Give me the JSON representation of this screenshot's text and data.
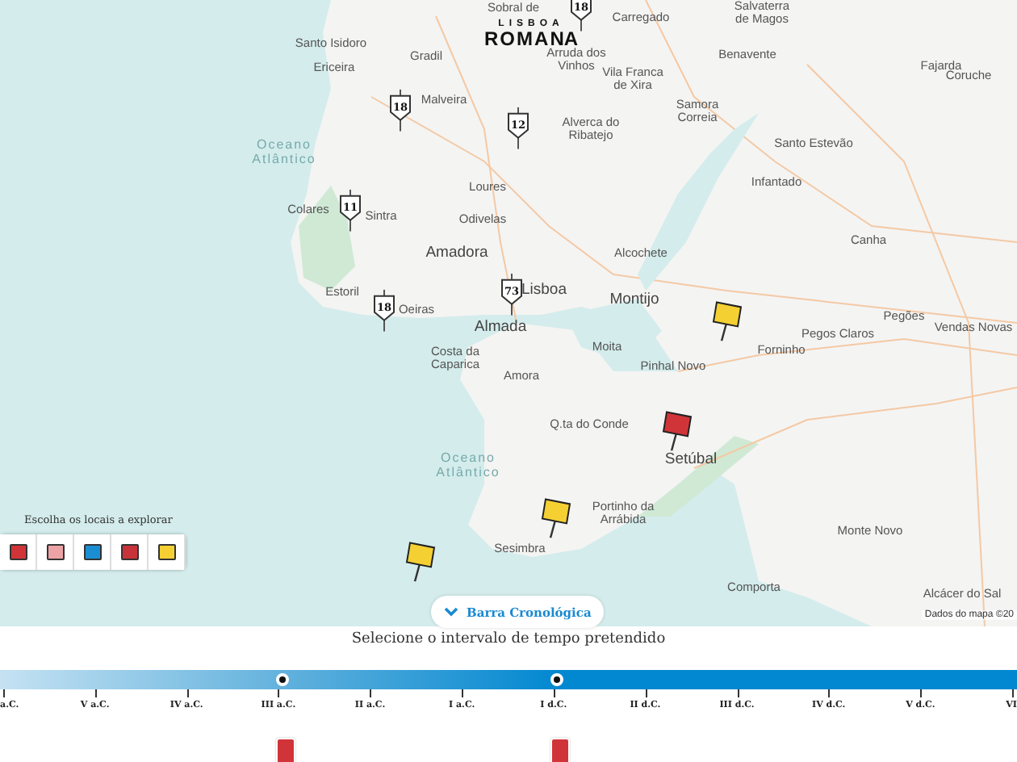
{
  "logo": {
    "top": "LISBOA",
    "main": [
      "R",
      "O",
      "M",
      "A",
      "NA"
    ]
  },
  "places": [
    {
      "name": "Sobral de"
    },
    {
      "name": "Carregado"
    },
    {
      "name": "Salvaterra\nde Magos"
    },
    {
      "name": "Santo Isidoro"
    },
    {
      "name": "Gradil"
    },
    {
      "name": "Arruda dos\nVinhos"
    },
    {
      "name": "Benavente"
    },
    {
      "name": "Fajarda"
    },
    {
      "name": "Coruche"
    },
    {
      "name": "Ericeira"
    },
    {
      "name": "Vila Franca\nde Xira"
    },
    {
      "name": "Malveira"
    },
    {
      "name": "Samora\nCorreia"
    },
    {
      "name": "Alverca do\nRibatejo"
    },
    {
      "name": "Santo Estevão"
    },
    {
      "name": "Oceano\nAtlântico",
      "kind": "sea"
    },
    {
      "name": "Infantado"
    },
    {
      "name": "Loures"
    },
    {
      "name": "Colares"
    },
    {
      "name": "Sintra"
    },
    {
      "name": "Odivelas"
    },
    {
      "name": "Canha"
    },
    {
      "name": "Amadora",
      "kind": "city"
    },
    {
      "name": "Alcochete"
    },
    {
      "name": "Lisboa",
      "kind": "city"
    },
    {
      "name": "Estoril"
    },
    {
      "name": "Montijo",
      "kind": "city"
    },
    {
      "name": "Oeiras"
    },
    {
      "name": "Pegões"
    },
    {
      "name": "Almada",
      "kind": "city"
    },
    {
      "name": "Vendas Novas"
    },
    {
      "name": "Pegos Claros"
    },
    {
      "name": "Costa da\nCaparica"
    },
    {
      "name": "Moita"
    },
    {
      "name": "Forninho"
    },
    {
      "name": "Pinhal Novo"
    },
    {
      "name": "Amora"
    },
    {
      "name": "Q.ta do Conde"
    },
    {
      "name": "Setúbal",
      "kind": "city"
    },
    {
      "name": "Oceano\nAtlântico",
      "kind": "sea"
    },
    {
      "name": "Portinho da\nArrábida"
    },
    {
      "name": "Sesimbra"
    },
    {
      "name": "Monte Novo"
    },
    {
      "name": "Comporta"
    },
    {
      "name": "Alcácer do Sal"
    }
  ],
  "markers": [
    {
      "kind": "count",
      "label": "18"
    },
    {
      "kind": "count",
      "label": "18"
    },
    {
      "kind": "count",
      "label": "12"
    },
    {
      "kind": "count",
      "label": "11"
    },
    {
      "kind": "count",
      "label": "73"
    },
    {
      "kind": "count",
      "label": "18"
    },
    {
      "kind": "flag",
      "color": "#f5d033"
    },
    {
      "kind": "flag",
      "color": "#d13438"
    },
    {
      "kind": "flag",
      "color": "#f5d033"
    },
    {
      "kind": "flag",
      "color": "#f5d033"
    }
  ],
  "attribution": "Dados do mapa ©20",
  "legend": {
    "title": "Escolha os locais a explorar",
    "items": [
      {
        "color": "#d13438"
      },
      {
        "color": "#eba3a5"
      },
      {
        "color": "#1b8ed3"
      },
      {
        "color": "#c8323a"
      },
      {
        "color": "#f5d033"
      }
    ]
  },
  "timeline": {
    "toggle": "Barra Cronológica",
    "title": "Selecione o intervalo de tempo pretendido",
    "ticks": [
      "a.C.",
      "V a.C.",
      "IV a.C.",
      "III a.C.",
      "II a.C.",
      "I a.C.",
      "I d.C.",
      "II d.C.",
      "III d.C.",
      "IV d.C.",
      "V d.C.",
      "VI"
    ],
    "handles": [
      {
        "level": 0.278
      },
      {
        "level": 0.548
      }
    ]
  }
}
